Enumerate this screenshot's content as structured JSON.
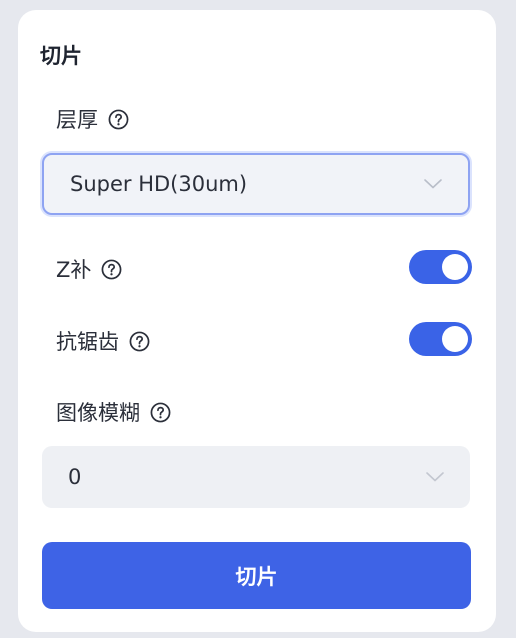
{
  "panel": {
    "title": "切片",
    "layer_thickness": {
      "label": "层厚",
      "help_icon": "question-circle-icon",
      "value": "Super HD(30um)",
      "dropdown_icon": "chevron-down-icon"
    },
    "z_compensation": {
      "label": "Z补",
      "help_icon": "question-circle-icon",
      "enabled": true
    },
    "anti_aliasing": {
      "label": "抗锯齿",
      "help_icon": "question-circle-icon",
      "enabled": true
    },
    "image_blur": {
      "label": "图像模糊",
      "help_icon": "question-circle-icon",
      "value": "0",
      "dropdown_icon": "chevron-down-icon"
    },
    "slice_button_label": "切片"
  },
  "colors": {
    "accent": "#3e63e6",
    "background": "#e6e8ee",
    "panel": "#ffffff"
  }
}
